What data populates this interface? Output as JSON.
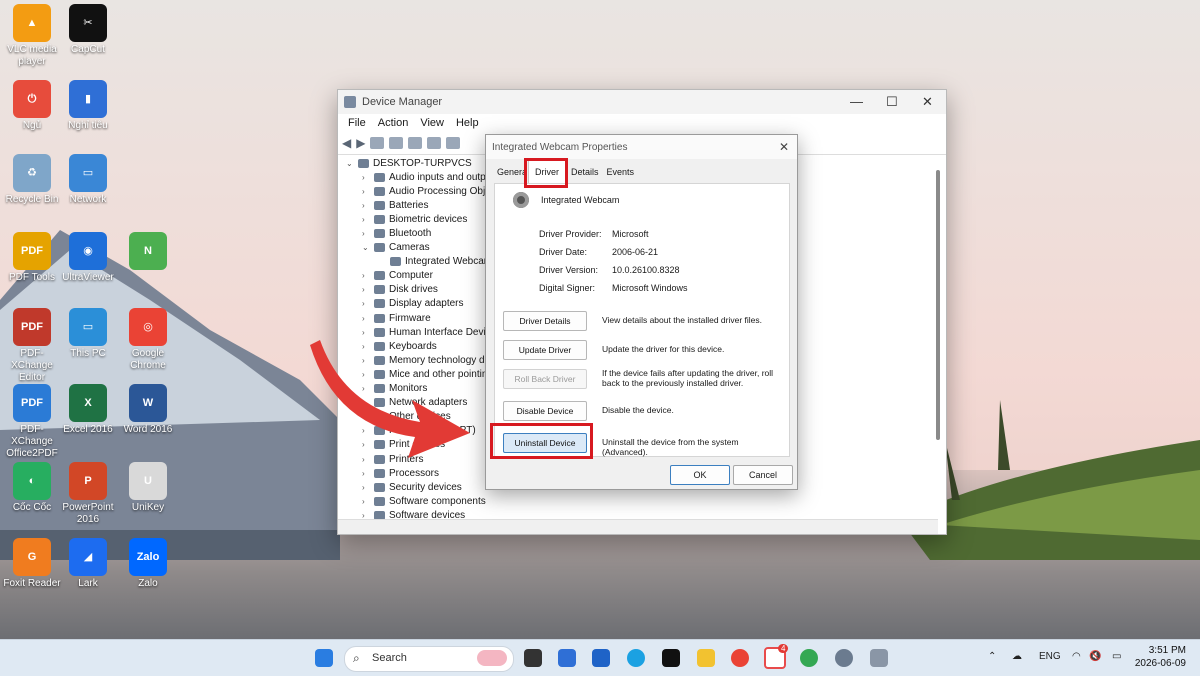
{
  "desktop": {
    "icons": [
      {
        "name": "vlc-icon",
        "label": "VLC media player",
        "glyph": "▲",
        "color": "#f39c12"
      },
      {
        "name": "capcut-icon",
        "label": "CapCut",
        "glyph": "✂",
        "color": "#111111"
      },
      {
        "name": "sleep-icon",
        "label": "Ngủ",
        "glyph": "⏻",
        "color": "#e74c3c"
      },
      {
        "name": "notes-icon",
        "label": "Nghỉ tiêu",
        "glyph": "▮",
        "color": "#2f6fd6"
      },
      {
        "name": "recycle-bin-icon",
        "label": "Recycle Bin",
        "glyph": "♻",
        "color": "#7fa6c9"
      },
      {
        "name": "network-icon",
        "label": "Network",
        "glyph": "▭",
        "color": "#3a87d6"
      },
      {
        "name": "pdf-tools-icon",
        "label": "PDF Tools",
        "glyph": "PDF",
        "color": "#e5a300"
      },
      {
        "name": "ultraviewer-icon",
        "label": "UltraViewer",
        "glyph": "◉",
        "color": "#1e6fd9"
      },
      {
        "name": "chrome-icon",
        "label": "",
        "glyph": "N",
        "color": "#4caf50"
      },
      {
        "name": "pdf-xchange-editor-icon",
        "label": "PDF-XChange Editor",
        "glyph": "PDF",
        "color": "#c0392b"
      },
      {
        "name": "this-pc-icon",
        "label": "This PC",
        "glyph": "▭",
        "color": "#2b8fd8"
      },
      {
        "name": "google-chrome-icon",
        "label": "Google Chrome",
        "glyph": "◎",
        "color": "#ea4335"
      },
      {
        "name": "pdf-xchange-office-icon",
        "label": "PDF-XChange Office2PDF",
        "glyph": "PDF",
        "color": "#2b7bd6"
      },
      {
        "name": "excel-icon",
        "label": "Excel 2016",
        "glyph": "X",
        "color": "#1f7244"
      },
      {
        "name": "word-icon",
        "label": "Word 2016",
        "glyph": "W",
        "color": "#2b5797"
      },
      {
        "name": "coccoc-icon",
        "label": "Cốc Cốc",
        "glyph": "◐",
        "color": "#27ae60"
      },
      {
        "name": "powerpoint-icon",
        "label": "PowerPoint 2016",
        "glyph": "P",
        "color": "#d24726"
      },
      {
        "name": "unikey-icon",
        "label": "UniKey",
        "glyph": "U",
        "color": "#d9d9d9"
      },
      {
        "name": "foxit-reader-icon",
        "label": "Foxit Reader",
        "glyph": "G",
        "color": "#f07c1f"
      },
      {
        "name": "lark-icon",
        "label": "Lark",
        "glyph": "◢",
        "color": "#1d6cf0"
      },
      {
        "name": "zalo-icon",
        "label": "Zalo",
        "glyph": "Zalo",
        "color": "#0068ff"
      }
    ]
  },
  "device_manager": {
    "title": "Device Manager",
    "menu": [
      "File",
      "Action",
      "View",
      "Help"
    ],
    "tree": [
      {
        "label": "DESKTOP-TURPVCS",
        "exp": "v",
        "indent": 0
      },
      {
        "label": "Audio inputs and outputs",
        "exp": ">",
        "indent": 1
      },
      {
        "label": "Audio Processing Objects (APOs)",
        "exp": ">",
        "indent": 1
      },
      {
        "label": "Batteries",
        "exp": ">",
        "indent": 1
      },
      {
        "label": "Biometric devices",
        "exp": ">",
        "indent": 1
      },
      {
        "label": "Bluetooth",
        "exp": ">",
        "indent": 1
      },
      {
        "label": "Cameras",
        "exp": "v",
        "indent": 1
      },
      {
        "label": "Integrated Webcam",
        "exp": "",
        "indent": 2
      },
      {
        "label": "Computer",
        "exp": ">",
        "indent": 1
      },
      {
        "label": "Disk drives",
        "exp": ">",
        "indent": 1
      },
      {
        "label": "Display adapters",
        "exp": ">",
        "indent": 1
      },
      {
        "label": "Firmware",
        "exp": ">",
        "indent": 1
      },
      {
        "label": "Human Interface Devices",
        "exp": ">",
        "indent": 1
      },
      {
        "label": "Keyboards",
        "exp": ">",
        "indent": 1
      },
      {
        "label": "Memory technology devices",
        "exp": ">",
        "indent": 1
      },
      {
        "label": "Mice and other pointing devices",
        "exp": ">",
        "indent": 1
      },
      {
        "label": "Monitors",
        "exp": ">",
        "indent": 1
      },
      {
        "label": "Network adapters",
        "exp": ">",
        "indent": 1
      },
      {
        "label": "Other devices",
        "exp": ">",
        "indent": 1
      },
      {
        "label": "Ports (COM & LPT)",
        "exp": ">",
        "indent": 1
      },
      {
        "label": "Print queues",
        "exp": ">",
        "indent": 1
      },
      {
        "label": "Printers",
        "exp": ">",
        "indent": 1
      },
      {
        "label": "Processors",
        "exp": ">",
        "indent": 1
      },
      {
        "label": "Security devices",
        "exp": ">",
        "indent": 1
      },
      {
        "label": "Software components",
        "exp": ">",
        "indent": 1
      },
      {
        "label": "Software devices",
        "exp": ">",
        "indent": 1
      }
    ]
  },
  "dialog": {
    "title": "Integrated Webcam Properties",
    "tabs": [
      "General",
      "Driver",
      "Details",
      "Events"
    ],
    "active_tab": "Driver",
    "device_name": "Integrated Webcam",
    "info": [
      {
        "label": "Driver Provider:",
        "value": "Microsoft"
      },
      {
        "label": "Driver Date:",
        "value": "2006-06-21"
      },
      {
        "label": "Driver Version:",
        "value": "10.0.26100.8328"
      },
      {
        "label": "Digital Signer:",
        "value": "Microsoft Windows"
      }
    ],
    "actions": [
      {
        "name": "driver-details-button",
        "label": "Driver Details",
        "desc": "View details about the installed driver files.",
        "state": "normal"
      },
      {
        "name": "update-driver-button",
        "label": "Update Driver",
        "desc": "Update the driver for this device.",
        "state": "normal"
      },
      {
        "name": "roll-back-driver-button",
        "label": "Roll Back Driver",
        "desc": "If the device fails after updating the driver, roll back to the previously installed driver.",
        "state": "disabled"
      },
      {
        "name": "disable-device-button",
        "label": "Disable Device",
        "desc": "Disable the device.",
        "state": "normal"
      },
      {
        "name": "uninstall-device-button",
        "label": "Uninstall Device",
        "desc": "Uninstall the device from the system (Advanced).",
        "state": "focus"
      }
    ],
    "ok_label": "OK",
    "cancel_label": "Cancel",
    "highlight_color": "#d71920"
  },
  "taskbar": {
    "search_placeholder": "Search",
    "language": "ENG",
    "time": "3:51 PM",
    "date": "2026-06-09",
    "badge_count": "4"
  }
}
